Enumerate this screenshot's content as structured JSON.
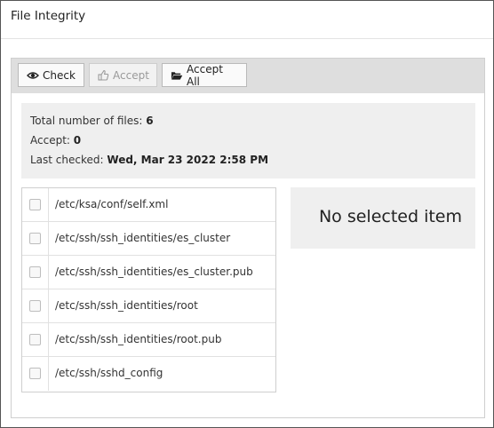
{
  "panel": {
    "title": "File Integrity"
  },
  "toolbar": {
    "check": {
      "label": "Check",
      "icon": "eye-icon"
    },
    "accept": {
      "label": "Accept",
      "icon": "thumbs-up-icon"
    },
    "accept_all": {
      "label": "Accept All",
      "icon": "folder-open-icon"
    }
  },
  "summary": {
    "total_label": "Total number of files:",
    "total_value": "6",
    "accept_label": "Accept:",
    "accept_value": "0",
    "last_checked_label": "Last checked:",
    "last_checked_value": "Wed, Mar 23 2022 2:58 PM"
  },
  "files": [
    {
      "path": "/etc/ksa/conf/self.xml",
      "checked": false
    },
    {
      "path": "/etc/ssh/ssh_identities/es_cluster",
      "checked": false
    },
    {
      "path": "/etc/ssh/ssh_identities/es_cluster.pub",
      "checked": false
    },
    {
      "path": "/etc/ssh/ssh_identities/root",
      "checked": false
    },
    {
      "path": "/etc/ssh/ssh_identities/root.pub",
      "checked": false
    },
    {
      "path": "/etc/ssh/sshd_config",
      "checked": false
    }
  ],
  "detail": {
    "message": "No selected item"
  }
}
